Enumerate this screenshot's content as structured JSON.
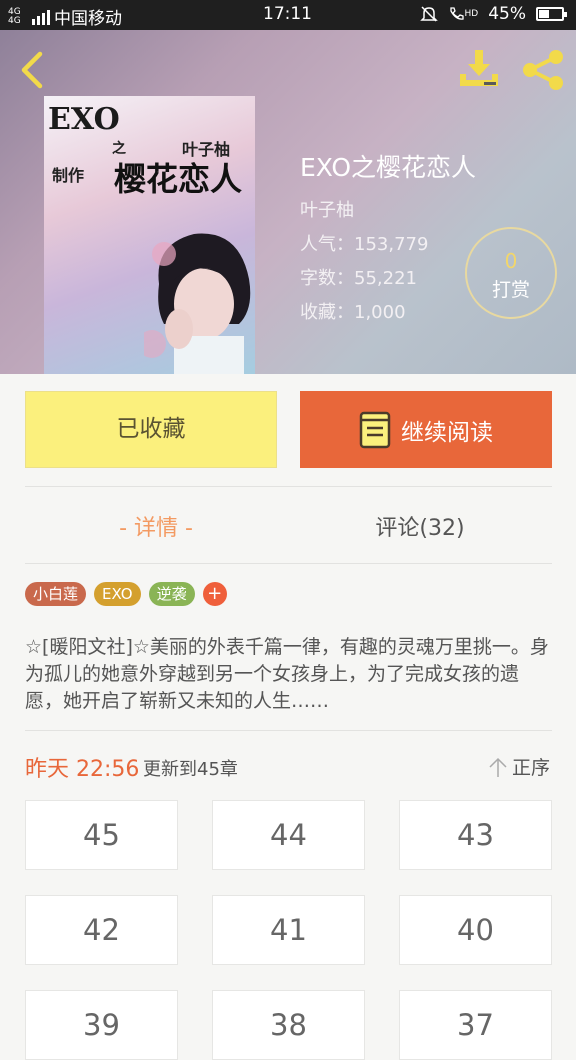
{
  "status_bar": {
    "signal_label": "4G 4G",
    "carrier": "中国移动",
    "time": "17:11",
    "hd": "HD",
    "battery": "45%",
    "battery_level": 0.45
  },
  "colors": {
    "accent": "#e8673a",
    "favorite_bg": "#fbf07d",
    "tab_active": "#f39a62",
    "reward_number": "#f2d66b"
  },
  "icons": {
    "back": "chevron-left-icon",
    "download": "download-icon",
    "share": "share-icon",
    "book": "book-icon",
    "sort": "arrow-up-icon"
  },
  "cover": {
    "title_line1": "EXO",
    "title_zhi": "之",
    "author": "叶子柚",
    "make": "制作",
    "title_line2": "樱花恋人"
  },
  "book": {
    "title": "EXO之樱花恋人",
    "author": "叶子柚",
    "popularity": "人气：153,779",
    "word_count": "字数：55,221",
    "favorites": "收藏：1,000"
  },
  "reward": {
    "count": "0",
    "label": "打赏"
  },
  "actions": {
    "favorite_label": "已收藏",
    "read_label": "继续阅读"
  },
  "tabs": {
    "detail": "- 详情 -",
    "comments": "评论(32)"
  },
  "tags": [
    {
      "label": "小白莲",
      "color": "#c9694c"
    },
    {
      "label": "EXO",
      "color": "#d4a02e"
    },
    {
      "label": "逆袭",
      "color": "#8ab455"
    }
  ],
  "tag_add": "+",
  "description": "☆[暖阳文社]☆美丽的外表千篇一律，有趣的灵魂万里挑一。身为孤儿的她意外穿越到另一个女孩身上，为了完成女孩的遗愿，她开启了崭新又未知的人生……",
  "update": {
    "time": "昨天 22:56",
    "text": "更新到45章",
    "sort_label": "正序"
  },
  "chapters": [
    "45",
    "44",
    "43",
    "42",
    "41",
    "40",
    "39",
    "38",
    "37"
  ]
}
